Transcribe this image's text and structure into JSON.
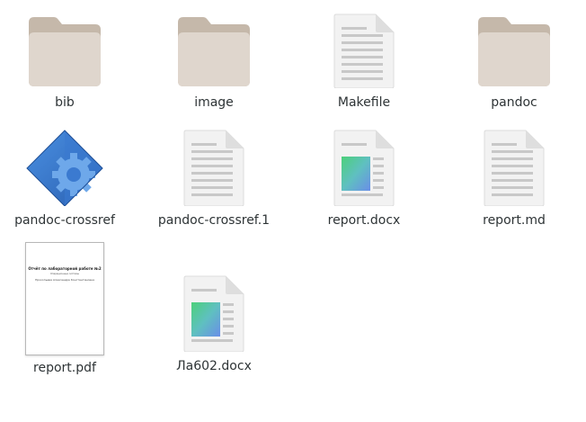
{
  "files": [
    {
      "name": "bib",
      "type": "folder-icon"
    },
    {
      "name": "image",
      "type": "folder-icon"
    },
    {
      "name": "Makefile",
      "type": "text-file-icon"
    },
    {
      "name": "pandoc",
      "type": "folder-icon"
    },
    {
      "name": "pandoc-crossref",
      "type": "executable-icon"
    },
    {
      "name": "pandoc-crossref.1",
      "type": "text-file-icon"
    },
    {
      "name": "report.docx",
      "type": "document-icon"
    },
    {
      "name": "report.md",
      "type": "text-file-icon"
    },
    {
      "name": "report.pdf",
      "type": "pdf-thumbnail"
    },
    {
      "name": "Ла602.docx",
      "type": "document-icon"
    }
  ],
  "pdf_preview": {
    "title": "Отчёт по лабораторной работе №2",
    "subtitle": "Операционные системы",
    "author": "Прокопьева Александра Константиновна"
  },
  "colors": {
    "folder_back": "#c5b8aa",
    "folder_front": "#dfd6cd",
    "page": "#f2f2f2",
    "page_lines": "#c8c8c8",
    "executable_blue": "#3b7ad0"
  }
}
